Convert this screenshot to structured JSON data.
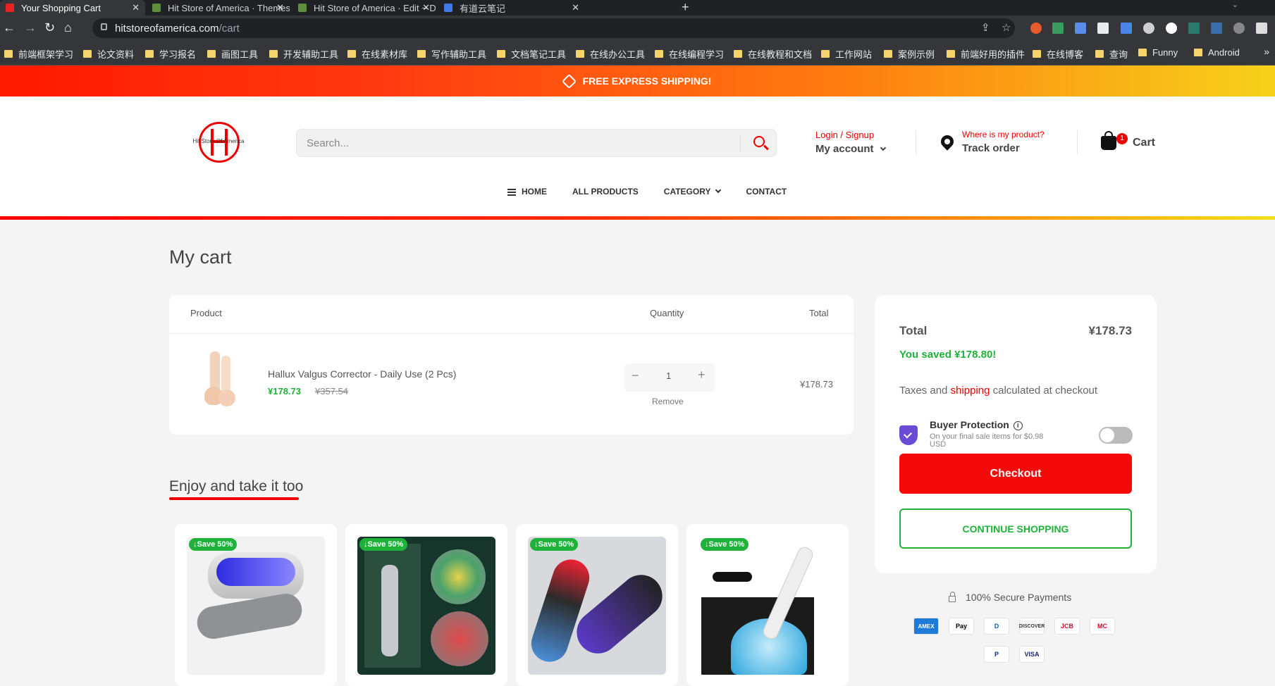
{
  "browser": {
    "tabs": [
      {
        "title": "Your Shopping Cart",
        "favicon_color": "#e22"
      },
      {
        "title": "Hit Store of America · Themes",
        "favicon_color": "#5e8e3e"
      },
      {
        "title": "Hit Store of America · Edit ~ D",
        "favicon_color": "#5e8e3e"
      },
      {
        "title": "有道云笔记",
        "favicon_color": "#3d7bea"
      }
    ],
    "new_tab_glyph": "+",
    "url_host": "hitstoreofamerica.com",
    "url_path": "/cart",
    "bookmarks": [
      "前端框架学习",
      "论文资料",
      "学习报名",
      "画图工具",
      "开发辅助工具",
      "在线素材库",
      "写作辅助工具",
      "文档笔记工具",
      "在线办公工具",
      "在线编程学习",
      "在线教程和文档",
      "工作网站",
      "案例示例",
      "前端好用的插件",
      "在线博客",
      "查询",
      "Funny",
      "Android"
    ],
    "bookmarks_more": "»"
  },
  "promo": {
    "text": "FREE EXPRESS SHIPPING!"
  },
  "header": {
    "logo_text": "Hit Store Of America",
    "search_placeholder": "Search...",
    "login_label": "Login / Signup",
    "account_label": "My account",
    "track_question": "Where is my product?",
    "track_label": "Track order",
    "cart_count": "1",
    "cart_label": "Cart"
  },
  "nav": {
    "home": "HOME",
    "all_products": "ALL PRODUCTS",
    "category": "CATEGORY",
    "contact": "CONTACT"
  },
  "cart": {
    "title": "My cart",
    "col_product": "Product",
    "col_quantity": "Quantity",
    "col_total": "Total",
    "item": {
      "name": "Hallux Valgus Corrector - Daily Use (2 Pcs)",
      "price": "¥178.73",
      "old_price": "¥357.54",
      "qty": "1",
      "minus": "−",
      "plus": "+",
      "remove": "Remove",
      "line_total": "¥178.73"
    }
  },
  "summary": {
    "total_label": "Total",
    "total_value": "¥178.73",
    "saved": "You saved ¥178.80!",
    "tax_pre": "Taxes and",
    "tax_link": "shipping",
    "tax_post": "calculated at checkout",
    "bp_title": "Buyer Protection",
    "bp_info": "i",
    "bp_sub": "On your final sale items for $0.98 USD",
    "bp_enabled": false,
    "checkout": "Checkout",
    "continue": "CONTINUE SHOPPING"
  },
  "secure": {
    "label": "100% Secure Payments",
    "methods": [
      "AMEX",
      "Pay",
      "D",
      "DISCOVER",
      "JCB",
      "MC",
      "P",
      "VISA"
    ]
  },
  "recommend": {
    "title": "Enjoy and take it too",
    "badges": [
      "↓Save 50%",
      "↓Save 50%",
      "↓Save 50%",
      "↓Save 50%"
    ]
  },
  "colors": {
    "accent": "#ff0000",
    "success": "#1fb23a",
    "promo_end": "#f6d21a"
  }
}
